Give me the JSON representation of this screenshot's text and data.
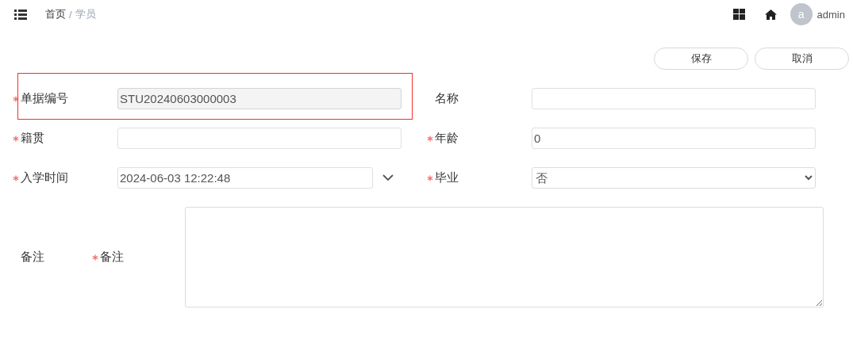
{
  "header": {
    "breadcrumb": [
      {
        "label": "首页",
        "current": false
      },
      {
        "label": "学员",
        "current": true
      }
    ],
    "separator": "/",
    "avatar_letter": "a",
    "user": "admin"
  },
  "buttons": [
    {
      "label": "保存"
    },
    {
      "label": "取消"
    }
  ],
  "fields": [
    {
      "label": "单据编号",
      "kind": "text",
      "required": true,
      "disabled": true,
      "highlighted": true,
      "value": "STU20240603000003"
    },
    {
      "label": "名称",
      "kind": "text",
      "required": false,
      "disabled": false,
      "highlighted": false
    },
    {
      "label": "籍贯",
      "kind": "text",
      "required": true,
      "disabled": false,
      "highlighted": false
    },
    {
      "label": "年龄",
      "kind": "text",
      "required": true,
      "disabled": false,
      "highlighted": false,
      "value": "0"
    },
    {
      "label": "入学时间",
      "kind": "date",
      "required": true,
      "disabled": false,
      "highlighted": false,
      "value": "2024-06-03 12:22:48"
    },
    {
      "label": "毕业",
      "kind": "select",
      "required": true,
      "disabled": false,
      "highlighted": false,
      "value": "否"
    }
  ],
  "remark": {
    "section_label": "备注",
    "label": "备注",
    "required": true
  }
}
